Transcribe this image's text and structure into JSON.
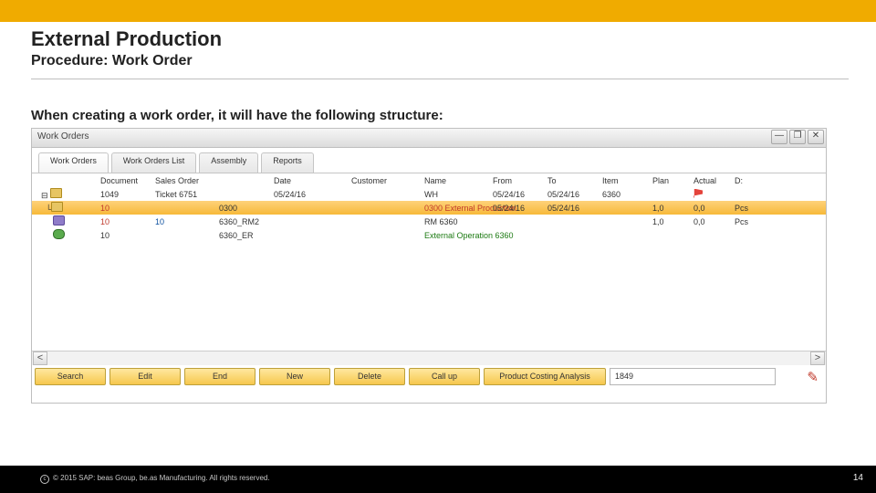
{
  "header": {
    "title": "External Production",
    "subtitle": "Procedure: Work Order",
    "intro": "When creating a work order, it will have the following structure:"
  },
  "window": {
    "title": "Work Orders",
    "minimize": "—",
    "restore": "❐",
    "close": "✕",
    "tabs": [
      {
        "label": "Work Orders",
        "active": true
      },
      {
        "label": "Work Orders List",
        "active": false
      },
      {
        "label": "Assembly",
        "active": false
      },
      {
        "label": "Reports",
        "active": false
      }
    ],
    "columns": [
      "",
      "Document",
      "Sales Order",
      "",
      "Date",
      "Customer",
      "Name",
      "From",
      "To",
      "Item",
      "Plan",
      "Actual",
      "D:"
    ],
    "rows": [
      {
        "c": [
          "",
          "1049",
          "Ticket 6751",
          "",
          "05/24/16",
          "",
          "WH",
          "05/24/16",
          "05/24/16",
          "6360",
          "",
          "",
          ""
        ],
        "flag": true,
        "ico": "folder"
      },
      {
        "c": [
          "",
          "10",
          "",
          "0300",
          "",
          "",
          "0300 External Production",
          "05/24/16",
          "05/24/16",
          "",
          "1,0",
          "0,0",
          "Pcs"
        ],
        "hl": true,
        "ico": "folder",
        "red1": true,
        "red2": true
      },
      {
        "c": [
          "",
          "10",
          "10",
          "6360_RM2",
          "",
          "",
          "RM 6360",
          "",
          "",
          "",
          "1,0",
          "0,0",
          "Pcs"
        ],
        "ico": "cart",
        "blue": true
      },
      {
        "c": [
          "",
          "10",
          "",
          "6360_ER",
          "",
          "",
          "External Operation 6360",
          "",
          "",
          "",
          "",
          "",
          ""
        ],
        "ico": "green",
        "green": true
      }
    ],
    "buttons": [
      "Search",
      "Edit",
      "End",
      "New",
      "Delete",
      "Call up"
    ],
    "wideButton": "Product Costing Analysis",
    "idfield": "1849",
    "scroll": {
      "left": "<",
      "right": ">"
    }
  },
  "footer": {
    "copyright": "© 2015 SAP: beas Group, be.as Manufacturing.  All rights reserved.",
    "page": "14"
  }
}
